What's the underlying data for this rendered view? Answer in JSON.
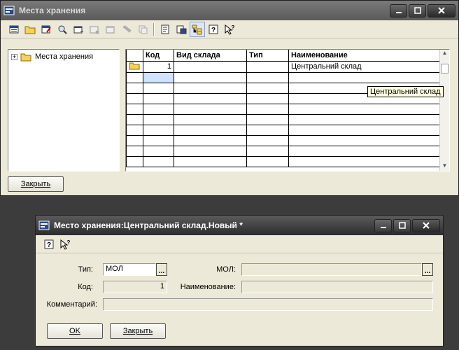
{
  "main_window": {
    "title": "Места хранения",
    "tree": {
      "root_label": "Места хранения",
      "expander": "+"
    },
    "grid": {
      "columns": [
        "Код",
        "Вид склада",
        "Тип",
        "Наименование"
      ],
      "rows": [
        {
          "code": "1",
          "type_of_warehouse": "",
          "type": "",
          "name": "Центральний склад"
        }
      ]
    },
    "tooltip": "Центральний склад",
    "close_button": "Закрыть",
    "toolbar_icons": [
      "new-icon",
      "new-folder-icon",
      "edit-icon",
      "find-icon",
      "copy-row-icon",
      "delete-icon",
      "mark-icon",
      "unmark-icon",
      "move-icon",
      "properties-icon",
      "print-icon",
      "tree-icon",
      "help-icon",
      "context-help-icon"
    ]
  },
  "dialog": {
    "title": "Место хранения:Центральний склад.Новый *",
    "fields": {
      "type_label": "Тип:",
      "type_value": "МОЛ",
      "mol_label": "МОЛ:",
      "mol_value": "",
      "code_label": "Код:",
      "code_value": "1",
      "name_label": "Наименование:",
      "name_value": "",
      "comment_label": "Комментарий:",
      "comment_value": ""
    },
    "ellipsis": "...",
    "ok_button": "OK",
    "close_button": "Закрыть"
  }
}
